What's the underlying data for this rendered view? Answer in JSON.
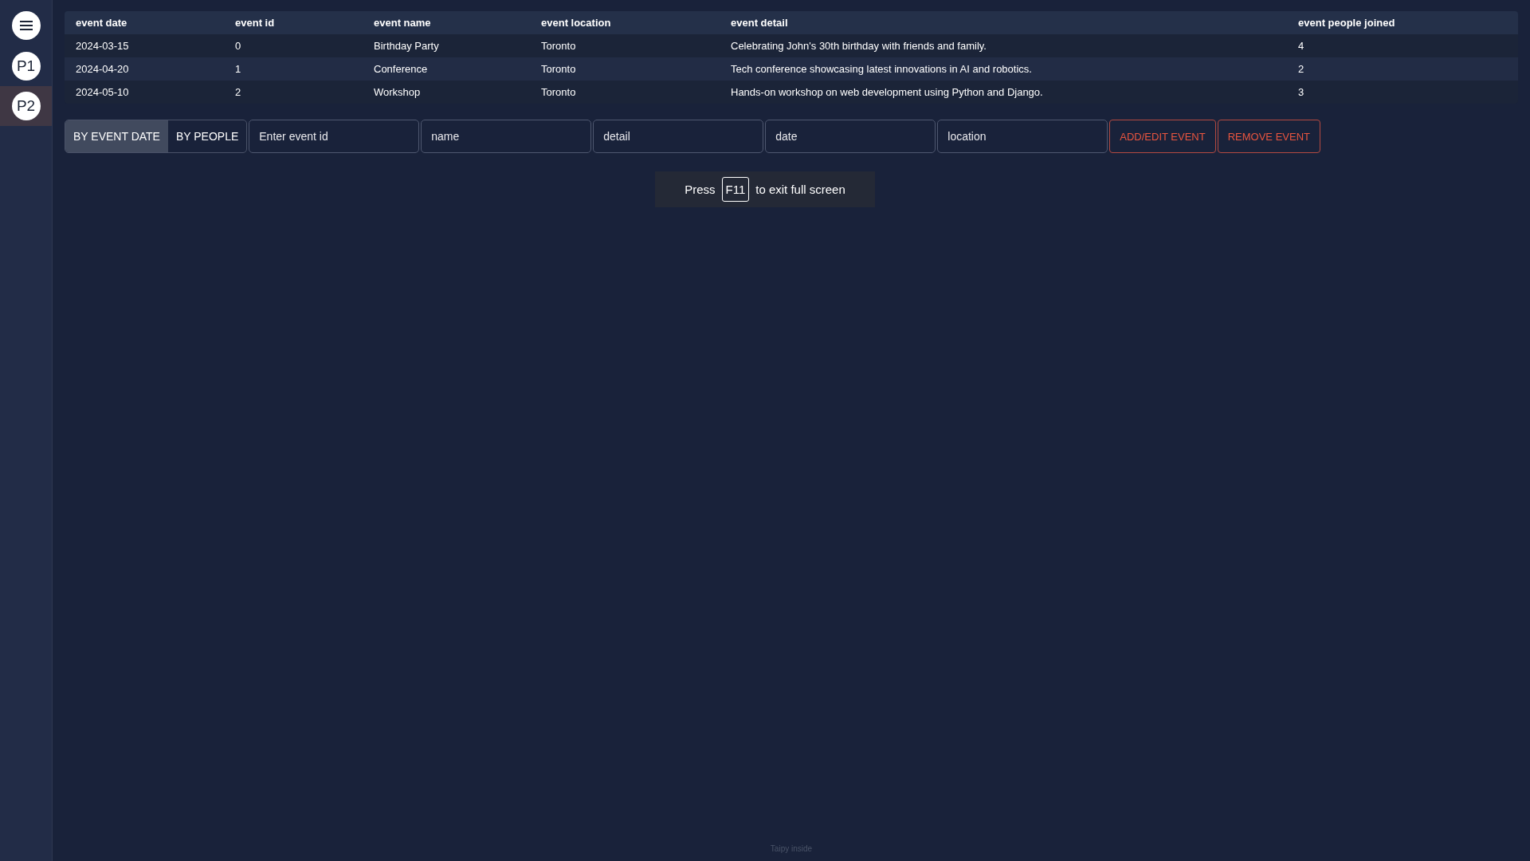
{
  "sidebar": {
    "pages": [
      {
        "label": "P1",
        "selected": false
      },
      {
        "label": "P2",
        "selected": true
      }
    ]
  },
  "table": {
    "columns": [
      "event date",
      "event id",
      "event name",
      "event location",
      "event detail",
      "event people joined"
    ],
    "rows": [
      [
        "2024-03-15",
        "0",
        "Birthday Party",
        "Toronto",
        "Celebrating John's 30th birthday with friends and family.",
        "4"
      ],
      [
        "2024-04-20",
        "1",
        "Conference",
        "Toronto",
        "Tech conference showcasing latest innovations in AI and robotics.",
        "2"
      ],
      [
        "2024-05-10",
        "2",
        "Workshop",
        "Toronto",
        "Hands-on workshop on web development using Python and Django.",
        "3"
      ]
    ]
  },
  "sort_toggle": [
    {
      "label": "BY EVENT DATE",
      "selected": true
    },
    {
      "label": "BY PEOPLE",
      "selected": false
    }
  ],
  "fields": [
    {
      "placeholder": "Enter event id"
    },
    {
      "placeholder": "name"
    },
    {
      "placeholder": "detail"
    },
    {
      "placeholder": "date"
    },
    {
      "placeholder": "location"
    }
  ],
  "buttons": [
    "ADD/EDIT EVENT",
    "REMOVE EVENT"
  ],
  "fullscreen_toast": {
    "before": "Press",
    "key": "F11",
    "after": "to exit full screen"
  },
  "footer": "Taipy inside"
}
